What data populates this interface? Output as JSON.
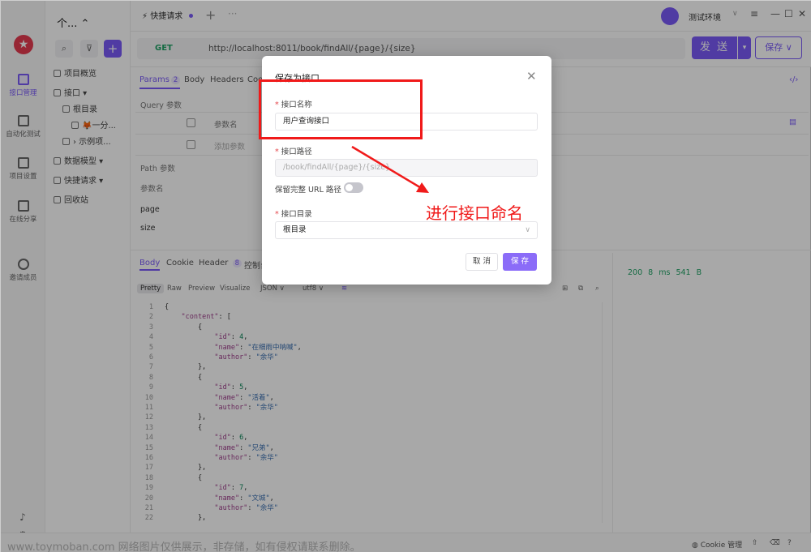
{
  "colors": {
    "accent": "#7a5af8",
    "annotation": "#f01a1a",
    "method_get": "#21a366",
    "status_ok": "#21a366"
  },
  "rail": {
    "items": [
      {
        "label": "接口管理",
        "icon": "api-icon"
      },
      {
        "label": "自动化测试",
        "icon": "test-icon"
      },
      {
        "label": "项目设置",
        "icon": "settings-icon"
      },
      {
        "label": "在线分享",
        "icon": "share-icon"
      },
      {
        "label": "邀请成员",
        "icon": "invite-icon"
      }
    ]
  },
  "tree": {
    "project_title": "个... ⌃",
    "items": [
      {
        "label": "项目概览",
        "icon": "overview-icon"
      },
      {
        "label": "接口 ▾",
        "icon": "api-folder-icon"
      },
      {
        "label": "根目录",
        "icon": "folder-icon"
      },
      {
        "label": "🦊一分...",
        "icon": "file-icon"
      },
      {
        "label": "› 示例项...",
        "icon": "folder-icon"
      },
      {
        "label": "数据模型 ▾",
        "icon": "model-icon"
      },
      {
        "label": "快捷请求 ▾",
        "icon": "quick-icon"
      },
      {
        "label": "回收站",
        "icon": "trash-icon"
      }
    ]
  },
  "topbar": {
    "tab_label": "⚡ 快捷请求",
    "plus": "+",
    "more": "···",
    "env_name": "测试环境",
    "env_caret": "∨",
    "menu": "≡",
    "minimize": "—",
    "maximize": "☐",
    "close": "✕"
  },
  "request": {
    "method": "GET",
    "url": "http://localhost:8011/book/findAll/{page}/{size}",
    "send_label": "发 送",
    "save_label": "保存 ∨",
    "tabs": {
      "params": "Params",
      "params_count": "2",
      "body": "Body",
      "headers": "Headers",
      "cookie": "Coo"
    },
    "query_label": "Query 参数",
    "col_param_name": "参数名",
    "add_param": "添加参数",
    "path_label": "Path 参数",
    "path_col": "参数名",
    "path_rows": [
      "page",
      "size"
    ]
  },
  "response": {
    "tabs": {
      "body": "Body",
      "cookie": "Cookie",
      "header": "Header",
      "header_count": "8",
      "console": "控制台"
    },
    "formats": [
      "Pretty",
      "Raw",
      "Preview",
      "Visualize",
      "JSON ∨",
      "utf8 ∨"
    ],
    "status": "200  8 ms  541 B"
  },
  "code_lines": [
    {
      "n": "1",
      "t": "{"
    },
    {
      "n": "2",
      "t": "    \"content\": ["
    },
    {
      "n": "3",
      "t": "        {"
    },
    {
      "n": "4",
      "t": "            \"id\": 4,"
    },
    {
      "n": "5",
      "t": "            \"name\": \"在细雨中呐喊\","
    },
    {
      "n": "6",
      "t": "            \"author\": \"余华\""
    },
    {
      "n": "7",
      "t": "        },"
    },
    {
      "n": "8",
      "t": "        {"
    },
    {
      "n": "9",
      "t": "            \"id\": 5,"
    },
    {
      "n": "10",
      "t": "            \"name\": \"活着\","
    },
    {
      "n": "11",
      "t": "            \"author\": \"余华\""
    },
    {
      "n": "12",
      "t": "        },"
    },
    {
      "n": "13",
      "t": "        {"
    },
    {
      "n": "14",
      "t": "            \"id\": 6,"
    },
    {
      "n": "15",
      "t": "            \"name\": \"兄弟\","
    },
    {
      "n": "16",
      "t": "            \"author\": \"余华\""
    },
    {
      "n": "17",
      "t": "        },"
    },
    {
      "n": "18",
      "t": "        {"
    },
    {
      "n": "19",
      "t": "            \"id\": 7,"
    },
    {
      "n": "20",
      "t": "            \"name\": \"文城\","
    },
    {
      "n": "21",
      "t": "            \"author\": \"余华\""
    },
    {
      "n": "22",
      "t": "        },"
    }
  ],
  "statusbar": {
    "watermark": "www.toymoban.com 网络图片仅供展示，非存储，如有侵权请联系删除。",
    "cookie_mgr": "◍ Cookie 管理"
  },
  "modal": {
    "title": "保存为接口",
    "close": "✕",
    "name_label": "接口名称",
    "name_value": "用户查询接口",
    "path_label": "接口路径",
    "path_value": "/book/findAll/{page}/{size}",
    "keep_full_url": "保留完整 URL 路径",
    "keep_full_url_on": false,
    "dir_label": "接口目录",
    "dir_value": "根目录",
    "required_mark": "*",
    "cancel": "取 消",
    "save": "保 存"
  },
  "annotation": {
    "text": "进行接口命名"
  }
}
